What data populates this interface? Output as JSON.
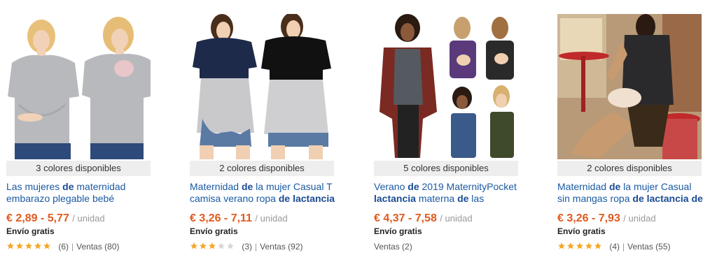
{
  "accent_price_color": "#e05a1e",
  "link_color": "#1a5aa3",
  "star_color": "#f5a623",
  "products": [
    {
      "colors": "3 colores disponibles",
      "title_parts": [
        {
          "t": "Las mujeres ",
          "b": false
        },
        {
          "t": "de",
          "b": true
        },
        {
          "t": " maternidad embarazo plegable bebé",
          "b": false
        }
      ],
      "price": "€ 2,89 - 5,77",
      "unit": "/ unidad",
      "shipping": "Envío gratis",
      "rating": 5,
      "reviews": "(6)",
      "sales": "Ventas (80)",
      "image": "maternity-gray-tshirt-two-models"
    },
    {
      "colors": "2 colores disponibles",
      "title_parts": [
        {
          "t": "Maternidad ",
          "b": false
        },
        {
          "t": "de",
          "b": true
        },
        {
          "t": " la mujer Casual T camisa verano ropa ",
          "b": false
        },
        {
          "t": "de lactancia",
          "b": true
        }
      ],
      "price": "€ 3,26 - 7,11",
      "unit": "/ unidad",
      "shipping": "Envío gratis",
      "rating": 3,
      "reviews": "(3)",
      "sales": "Ventas (92)",
      "image": "navy-black-colorblock-nursing-tops"
    },
    {
      "colors": "5 colores disponibles",
      "title_parts": [
        {
          "t": "Verano ",
          "b": false
        },
        {
          "t": "de",
          "b": true
        },
        {
          "t": " 2019 MaternityPocket ",
          "b": false
        },
        {
          "t": "lactancia",
          "b": true
        },
        {
          "t": " materna ",
          "b": false
        },
        {
          "t": "de",
          "b": true
        },
        {
          "t": " las mujeres",
          "b": false
        }
      ],
      "price": "€ 4,37 - 7,58",
      "unit": "/ unidad",
      "shipping": "Envío gratis",
      "rating": 0,
      "reviews": "",
      "sales": "Ventas (2)",
      "image": "babywearing-tank-collage"
    },
    {
      "colors": "2 colores disponibles",
      "title_parts": [
        {
          "t": "Maternidad ",
          "b": false
        },
        {
          "t": "de",
          "b": true
        },
        {
          "t": " la mujer Casual sin mangas ropa ",
          "b": false
        },
        {
          "t": "de lactancia de",
          "b": true
        }
      ],
      "price": "€ 3,26 - 7,93",
      "unit": "/ unidad",
      "shipping": "Envío gratis",
      "rating": 5,
      "reviews": "(4)",
      "sales": "Ventas (55)",
      "image": "black-sleeveless-nursing-top-cafe"
    }
  ]
}
